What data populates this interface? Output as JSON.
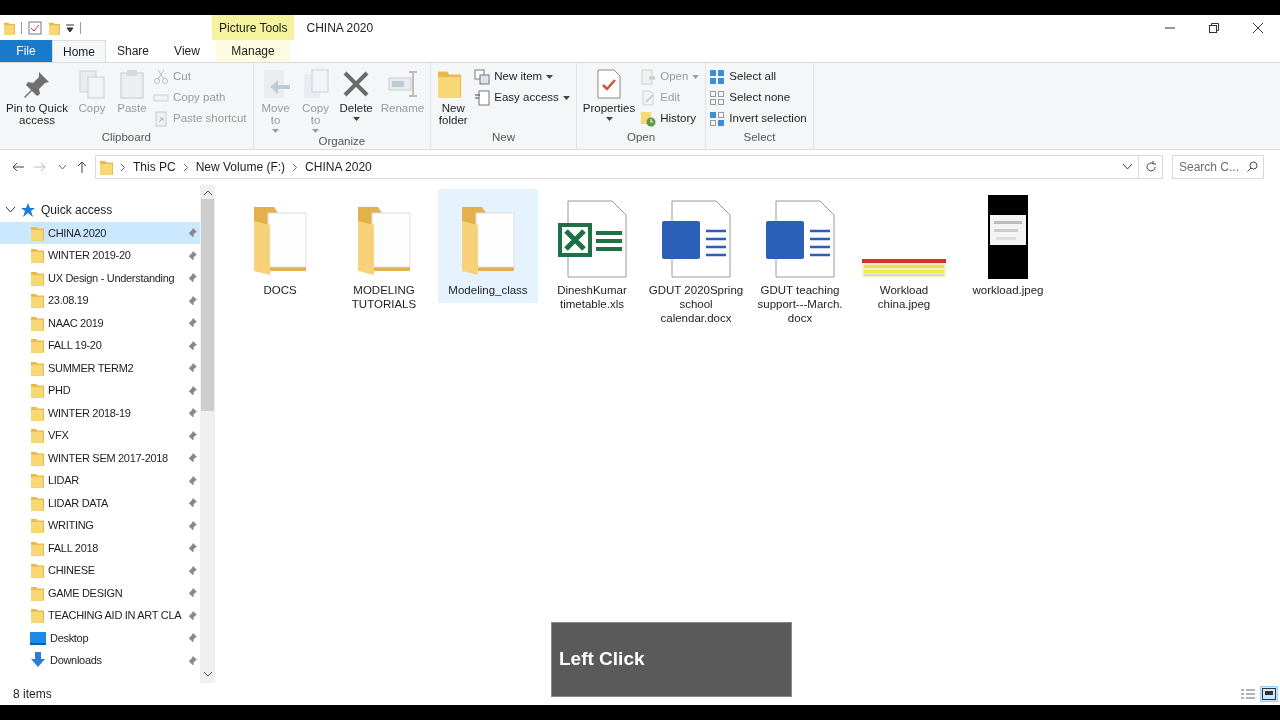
{
  "window": {
    "title": "CHINA 2020",
    "context_tab": "Picture Tools"
  },
  "tabs": [
    {
      "label": "File",
      "kind": "file",
      "selected": false
    },
    {
      "label": "Home",
      "kind": "tab",
      "selected": true
    },
    {
      "label": "Share",
      "kind": "tab",
      "selected": false
    },
    {
      "label": "View",
      "kind": "tab",
      "selected": false
    },
    {
      "label": "Manage",
      "kind": "context",
      "selected": false
    }
  ],
  "ribbon": {
    "groups": [
      {
        "label": "Clipboard",
        "buttons": [
          {
            "label": "Pin to Quick\naccess",
            "kind": "large",
            "disabled": false
          },
          {
            "label": "Copy",
            "kind": "large",
            "disabled": true
          },
          {
            "label": "Paste",
            "kind": "large",
            "disabled": true
          },
          {
            "label": "Cut",
            "kind": "small",
            "disabled": true
          },
          {
            "label": "Copy path",
            "kind": "small",
            "disabled": true
          },
          {
            "label": "Paste shortcut",
            "kind": "small",
            "disabled": true
          }
        ]
      },
      {
        "label": "Organize",
        "buttons": [
          {
            "label": "Move\nto",
            "kind": "large",
            "disabled": true,
            "dropdown": true
          },
          {
            "label": "Copy\nto",
            "kind": "large",
            "disabled": true,
            "dropdown": true
          },
          {
            "label": "Delete",
            "kind": "large",
            "disabled": false,
            "dropdown": true
          },
          {
            "label": "Rename",
            "kind": "large",
            "disabled": true
          }
        ]
      },
      {
        "label": "New",
        "buttons": [
          {
            "label": "New\nfolder",
            "kind": "large",
            "disabled": false
          },
          {
            "label": "New item",
            "kind": "small",
            "disabled": false,
            "dropdown": true
          },
          {
            "label": "Easy access",
            "kind": "small",
            "disabled": false,
            "dropdown": true
          }
        ]
      },
      {
        "label": "Open",
        "buttons": [
          {
            "label": "Properties",
            "kind": "large",
            "disabled": false,
            "dropdown": true
          },
          {
            "label": "Open",
            "kind": "small",
            "disabled": true,
            "dropdown": true
          },
          {
            "label": "Edit",
            "kind": "small",
            "disabled": true
          },
          {
            "label": "History",
            "kind": "small",
            "disabled": false
          }
        ]
      },
      {
        "label": "Select",
        "buttons": [
          {
            "label": "Select all",
            "kind": "small",
            "disabled": false
          },
          {
            "label": "Select none",
            "kind": "small",
            "disabled": false
          },
          {
            "label": "Invert selection",
            "kind": "small",
            "disabled": false
          }
        ]
      }
    ]
  },
  "address": {
    "breadcrumbs": [
      "This PC",
      "New Volume (F:)",
      "CHINA 2020"
    ],
    "search_placeholder": "Search C..."
  },
  "navigation": {
    "quick_access": {
      "label": "Quick access",
      "expanded": true,
      "items": [
        {
          "label": "CHINA 2020",
          "kind": "folder",
          "pinned": true,
          "selected": true
        },
        {
          "label": "WINTER 2019-20",
          "kind": "folder",
          "pinned": true,
          "selected": false
        },
        {
          "label": "UX Design - Understanding",
          "kind": "folder",
          "pinned": true,
          "selected": false
        },
        {
          "label": "23.08.19",
          "kind": "folder",
          "pinned": true,
          "selected": false
        },
        {
          "label": "NAAC 2019",
          "kind": "folder",
          "pinned": true,
          "selected": false
        },
        {
          "label": "FALL 19-20",
          "kind": "folder",
          "pinned": true,
          "selected": false
        },
        {
          "label": "SUMMER TERM2",
          "kind": "folder",
          "pinned": true,
          "selected": false
        },
        {
          "label": "PHD",
          "kind": "folder",
          "pinned": true,
          "selected": false
        },
        {
          "label": "WINTER 2018-19",
          "kind": "folder",
          "pinned": true,
          "selected": false
        },
        {
          "label": "VFX",
          "kind": "folder",
          "pinned": true,
          "selected": false
        },
        {
          "label": "WINTER SEM 2017-2018",
          "kind": "folder",
          "pinned": true,
          "selected": false
        },
        {
          "label": "LIDAR",
          "kind": "folder",
          "pinned": true,
          "selected": false
        },
        {
          "label": "LIDAR DATA",
          "kind": "folder",
          "pinned": true,
          "selected": false
        },
        {
          "label": "WRITING",
          "kind": "folder",
          "pinned": true,
          "selected": false
        },
        {
          "label": "FALL 2018",
          "kind": "folder",
          "pinned": true,
          "selected": false
        },
        {
          "label": "CHINESE",
          "kind": "folder",
          "pinned": true,
          "selected": false
        },
        {
          "label": "GAME DESIGN",
          "kind": "folder",
          "pinned": true,
          "selected": false
        },
        {
          "label": "TEACHING AID IN ART CLA",
          "kind": "folder",
          "pinned": true,
          "selected": false
        },
        {
          "label": "Desktop",
          "kind": "desktop",
          "pinned": true,
          "selected": false
        },
        {
          "label": "Downloads",
          "kind": "downloads",
          "pinned": true,
          "selected": false
        }
      ]
    }
  },
  "files": [
    {
      "name": "DOCS",
      "kind": "folder",
      "selected": false
    },
    {
      "name": "MODELING TUTORIALS",
      "kind": "folder",
      "selected": false
    },
    {
      "name": "Modeling_class",
      "kind": "folder",
      "selected": true
    },
    {
      "name": "DineshKumar timetable.xls",
      "kind": "excel",
      "selected": false
    },
    {
      "name": "GDUT 2020Spring school calendar.docx",
      "kind": "word",
      "selected": false
    },
    {
      "name": "GDUT teaching support---March. docx",
      "kind": "word",
      "selected": false
    },
    {
      "name": "Workload china.jpeg",
      "kind": "wide_image",
      "selected": false
    },
    {
      "name": "workload.jpeg",
      "kind": "tall_image",
      "selected": false
    }
  ],
  "status_bar": {
    "item_count": "8 items",
    "views": [
      {
        "kind": "details",
        "selected": false
      },
      {
        "kind": "large_icons",
        "selected": true
      }
    ]
  },
  "overlay": {
    "text": "Left Click"
  }
}
